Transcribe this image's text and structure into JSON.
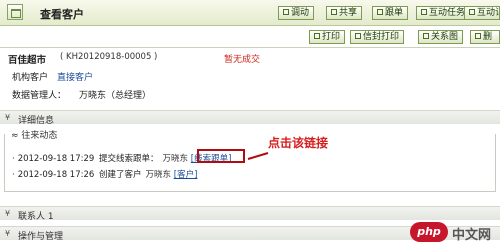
{
  "header": {
    "title": "查看客户",
    "buttons": [
      "调动",
      "共享",
      "跟单",
      "互动任务",
      "互动记录"
    ],
    "secondary_buttons": [
      "打印",
      "信封打印",
      "关系图",
      "删"
    ]
  },
  "customer": {
    "name": "百佳超市",
    "code": "( KH20120918-00005 )",
    "status": "暂无成交",
    "type_label": "机构客户",
    "type_link": "直接客户",
    "manager_label": "数据管理人：",
    "manager_value": "万晓东（总经理）"
  },
  "sections": {
    "details": "详细信息",
    "activity": "往来动态",
    "contacts": "联系人 1",
    "operations": "操作与管理"
  },
  "activities": [
    {
      "datetime": "2012-09-18 17:29",
      "action": "提交线索跟单：",
      "user": "万晓东",
      "link": "[线索跟单]"
    },
    {
      "datetime": "2012-09-18 17:26",
      "action": "创建了客户",
      "user": "万晓东",
      "link": "[客户]"
    }
  ],
  "annotation": {
    "text": "点击该链接",
    "color": "#d61f1f"
  },
  "watermark": {
    "logo": "php",
    "text": "中文网"
  }
}
